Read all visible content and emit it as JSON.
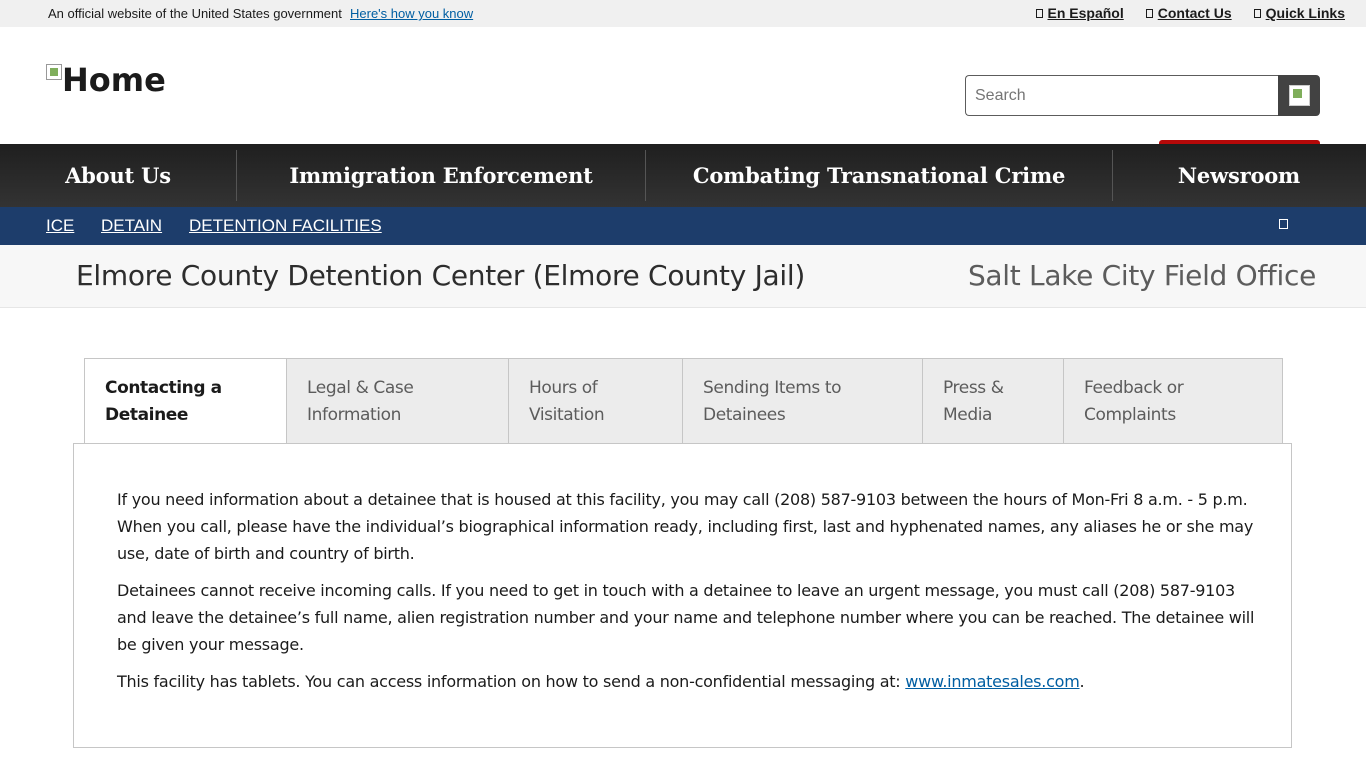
{
  "gov_banner": {
    "official_text": "An official website of the United States government",
    "how_you_know": "Here's how you know"
  },
  "top_links": [
    {
      "label": "En Español",
      "icon": "language-icon"
    },
    {
      "label": "Contact Us",
      "icon": "contact-icon"
    },
    {
      "label": "Quick Links",
      "icon": "link-icon"
    }
  ],
  "header": {
    "logo_alt": "Home",
    "search_placeholder": "Search"
  },
  "main_nav": [
    {
      "label": "About Us"
    },
    {
      "label": "Immigration Enforcement"
    },
    {
      "label": "Combating Transnational Crime"
    },
    {
      "label": "Newsroom"
    }
  ],
  "breadcrumb": [
    {
      "label": "ICE"
    },
    {
      "label": "DETAIN"
    },
    {
      "label": "DETENTION FACILITIES"
    }
  ],
  "page": {
    "title": "Elmore County Detention Center (Elmore County Jail)",
    "field_office": "Salt Lake City Field Office"
  },
  "tabs": [
    {
      "line1": "Contacting a",
      "line2": "Detainee",
      "active": true
    },
    {
      "line1": "Legal & Case",
      "line2": "Information",
      "active": false
    },
    {
      "line1": "Hours of",
      "line2": "Visitation",
      "active": false
    },
    {
      "line1": "Sending Items to",
      "line2": "Detainees",
      "active": false
    },
    {
      "line1": "Press &",
      "line2": "Media",
      "active": false
    },
    {
      "line1": "Feedback or",
      "line2": "Complaints",
      "active": false
    }
  ],
  "content": {
    "p1": "If you need information about a detainee that is housed at this facility, you may call (208) 587-9103 between the hours of Mon-Fri 8 a.m. - 5 p.m. When you call, please have the individual’s biographical information ready, including first, last and hyphenated names, any aliases he or she may use, date of birth and country of birth.",
    "p2": "Detainees cannot receive incoming calls. If you need to get in touch with a detainee to leave an urgent message, you must call (208) 587-9103 and leave the detainee’s full name, alien registration number and your name and telephone number where you can be reached. The detainee will be given your message.",
    "p3_prefix": "This facility has tablets. You can access information on how to send a non-confidential messaging at: ",
    "p3_link": "www.inmatesales.com",
    "p3_suffix": "."
  },
  "colors": {
    "nav_bg": "#2b2b2b",
    "breadcrumb_bg": "#1d3d6b",
    "accent_red": "#b50909",
    "link_blue": "#005ea2"
  }
}
